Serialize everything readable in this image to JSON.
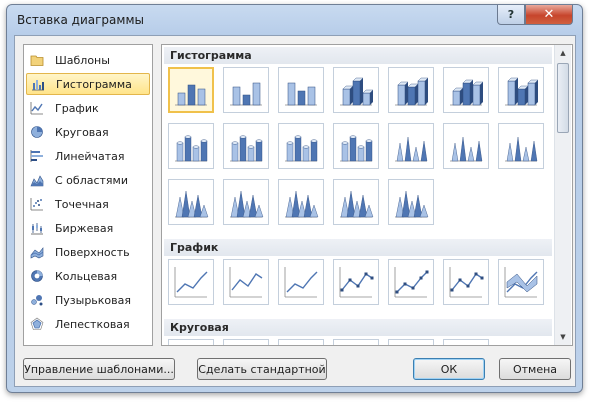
{
  "window": {
    "title": "Вставка диаграммы",
    "help_label": "?",
    "close_label": "✕"
  },
  "categories": [
    {
      "label": "Шаблоны",
      "icon": "folder-icon",
      "selected": false
    },
    {
      "label": "Гистограмма",
      "icon": "column-chart-icon",
      "selected": true
    },
    {
      "label": "График",
      "icon": "line-chart-icon",
      "selected": false
    },
    {
      "label": "Круговая",
      "icon": "pie-chart-icon",
      "selected": false
    },
    {
      "label": "Линейчатая",
      "icon": "bar-chart-icon",
      "selected": false
    },
    {
      "label": "С областями",
      "icon": "area-chart-icon",
      "selected": false
    },
    {
      "label": "Точечная",
      "icon": "scatter-chart-icon",
      "selected": false
    },
    {
      "label": "Биржевая",
      "icon": "stock-chart-icon",
      "selected": false
    },
    {
      "label": "Поверхность",
      "icon": "surface-chart-icon",
      "selected": false
    },
    {
      "label": "Кольцевая",
      "icon": "doughnut-chart-icon",
      "selected": false
    },
    {
      "label": "Пузырьковая",
      "icon": "bubble-chart-icon",
      "selected": false
    },
    {
      "label": "Лепестковая",
      "icon": "radar-chart-icon",
      "selected": false
    }
  ],
  "gallery": {
    "sections": [
      {
        "title": "Гистограмма",
        "thumb_count": 19,
        "kind": "column"
      },
      {
        "title": "График",
        "thumb_count": 7,
        "kind": "line"
      },
      {
        "title": "Круговая",
        "thumb_count": 6,
        "kind": "pie"
      }
    ]
  },
  "buttons": {
    "manage_templates": "Управление шаблонами...",
    "set_default": "Сделать стандартной",
    "ok": "ОК",
    "cancel": "Отмена"
  },
  "colors": {
    "accent_selected": "#ffe48a",
    "chart_blue": "#4f76b3",
    "close_red": "#c7452c"
  }
}
